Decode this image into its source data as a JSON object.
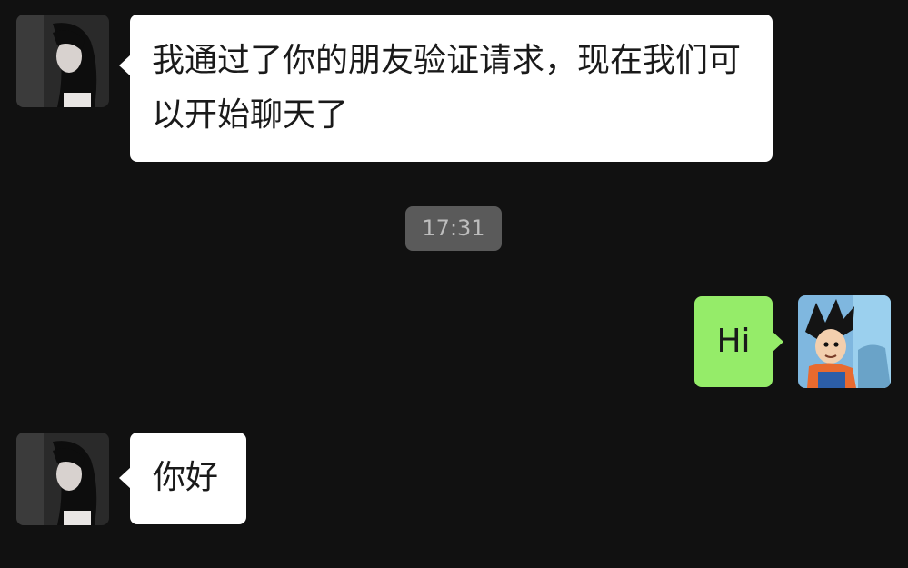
{
  "conversation": {
    "messages": [
      {
        "sender": "contact",
        "text": "我通过了你的朋友验证请求，现在我们可以开始聊天了",
        "avatar_icon": "contact-avatar-girl-photo"
      },
      {
        "sender": "self",
        "text": "Hi",
        "avatar_icon": "self-avatar-anime-boy"
      },
      {
        "sender": "contact",
        "text": "你好",
        "avatar_icon": "contact-avatar-girl-photo"
      }
    ],
    "timestamp": "17:31"
  },
  "colors": {
    "background": "#111111",
    "incoming_bubble": "#ffffff",
    "outgoing_bubble": "#95ec69",
    "timestamp_pill": "#5a5a5a",
    "timestamp_text": "#bdbdbd"
  }
}
